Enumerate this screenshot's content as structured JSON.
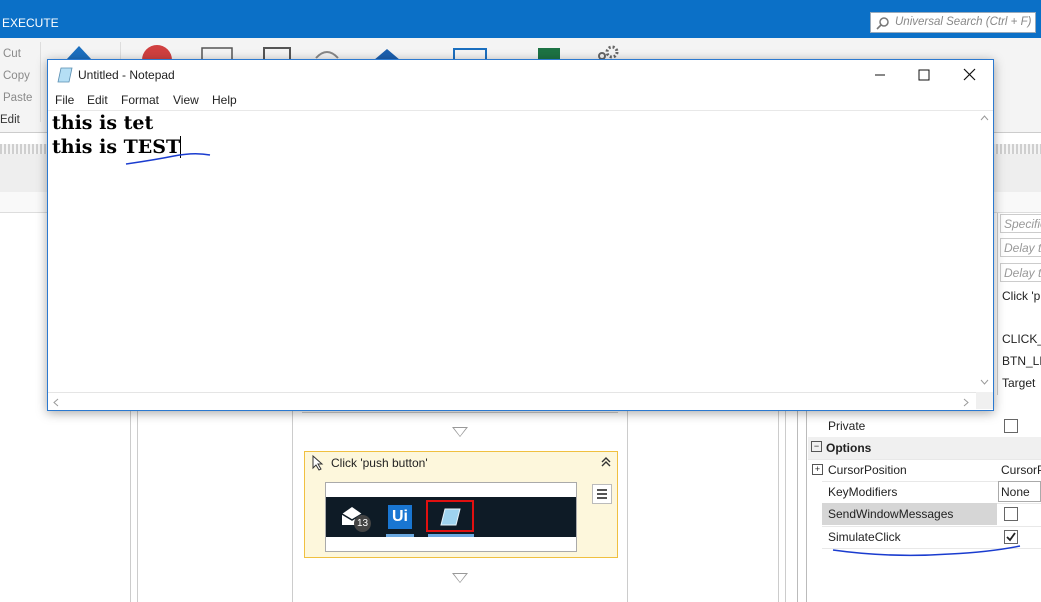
{
  "app": {
    "tab_label": "EXECUTE",
    "search_placeholder": "Universal Search (Ctrl + F)"
  },
  "ribbon": {
    "clipboard": [
      "Cut",
      "Copy",
      "Paste"
    ],
    "group_label": "Edit"
  },
  "designer": {
    "activity_title": "Click 'push button'",
    "taskbar_badge": "13",
    "taskbar_app_label": "Ui"
  },
  "properties": {
    "partial_values": {
      "input1": "Specifie",
      "input2": "Delay t",
      "input3": "Delay t",
      "text1": "Click 'p",
      "text2": "CLICK_S",
      "text3": "BTN_LE",
      "text4": "Target"
    },
    "rows": [
      {
        "name": "Private",
        "type": "checkbox",
        "checked": false
      },
      {
        "name": "Options",
        "type": "category"
      },
      {
        "name": "CursorPosition",
        "type": "expandable",
        "value": "CursorP"
      },
      {
        "name": "KeyModifiers",
        "type": "select",
        "value": "None"
      },
      {
        "name": "SendWindowMessages",
        "type": "checkbox",
        "checked": false,
        "selected": true
      },
      {
        "name": "SimulateClick",
        "type": "checkbox",
        "checked": true
      }
    ]
  },
  "notepad": {
    "title": "Untitled - Notepad",
    "menu": [
      "File",
      "Edit",
      "Format",
      "View",
      "Help"
    ],
    "lines": [
      "this is tet",
      "this is TEST"
    ]
  },
  "colors": {
    "title_bar": "#0b70c7",
    "activity_border": "#f0c040",
    "annotation": "#1a3ccf",
    "highlight": "#e01010"
  }
}
